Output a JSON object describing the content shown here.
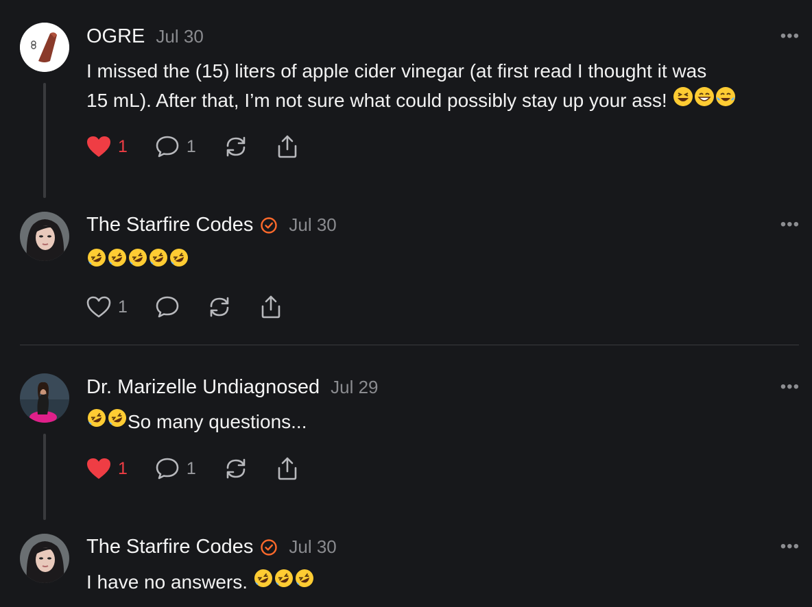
{
  "posts": [
    {
      "author": "OGRE",
      "time": "Jul 30",
      "text_line1": "I missed the (15) liters of apple cider vinegar (at first read I thought it was",
      "text_line2": "15 mL). After that, I’m not sure what could possibly stay up your ass!",
      "trailing_emojis": [
        "grinning-squint",
        "grinning",
        "tears-of-joy"
      ],
      "likes": "1",
      "liked": true,
      "replies": "1"
    },
    {
      "author": "The Starfire Codes",
      "verified": true,
      "time": "Jul 30",
      "text": "",
      "emojis": [
        "rofl",
        "rofl",
        "rofl",
        "rofl",
        "rofl"
      ],
      "likes": "1",
      "liked": false,
      "replies": ""
    },
    {
      "author": "Dr. Marizelle Undiagnosed",
      "time": "Jul 29",
      "text": "So many questions...",
      "leading_emojis": [
        "rofl",
        "rofl"
      ],
      "likes": "1",
      "liked": true,
      "replies": "1"
    },
    {
      "author": "The Starfire Codes",
      "verified": true,
      "time": "Jul 30",
      "text": "I have no answers. ",
      "trailing_emojis": [
        "rofl",
        "rofl",
        "rofl"
      ]
    }
  ],
  "more_label": "•••",
  "colors": {
    "background": "#17181b",
    "liked": "#ef3d44",
    "verified": "#ff6a2b",
    "muted": "#8a8b8f"
  }
}
